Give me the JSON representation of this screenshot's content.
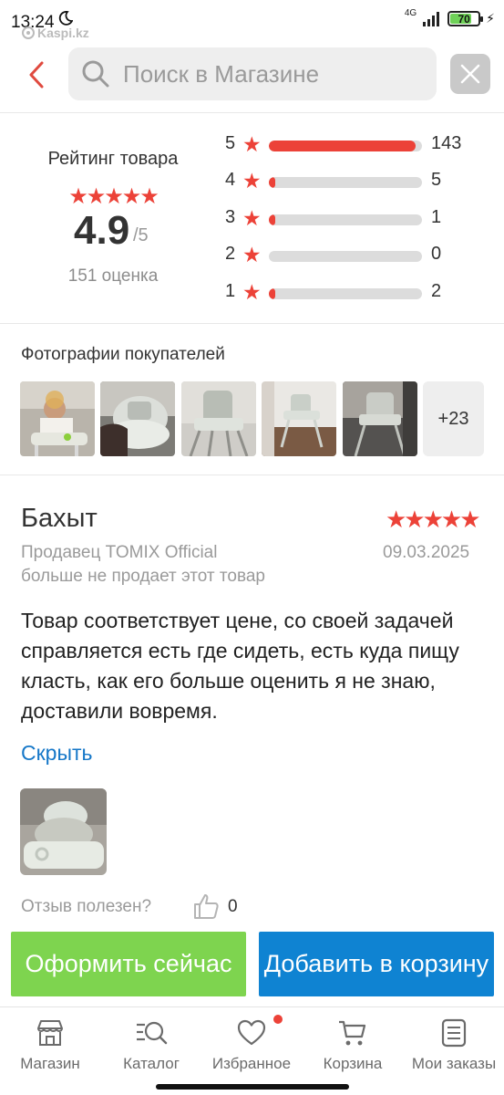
{
  "status_bar": {
    "time": "13:24",
    "app_name": "Kaspi.kz",
    "network": "4G",
    "battery": "70"
  },
  "header": {
    "search_placeholder": "Поиск в Магазине"
  },
  "rating": {
    "title": "Рейтинг товара",
    "stars": "★★★★★",
    "score": "4.9",
    "max": "/5",
    "count_text": "151 оценка",
    "rows": [
      {
        "stars": "5",
        "count": "143",
        "fraction": 0.96
      },
      {
        "stars": "4",
        "count": "5",
        "fraction": 0.035
      },
      {
        "stars": "3",
        "count": "1",
        "fraction": 0.007
      },
      {
        "stars": "2",
        "count": "0",
        "fraction": 0
      },
      {
        "stars": "1",
        "count": "2",
        "fraction": 0.014
      }
    ]
  },
  "photos": {
    "title": "Фотографии покупателей",
    "more_label": "+23"
  },
  "review": {
    "author": "Бахыт",
    "stars": "★★★★★",
    "seller": "Продавец TOMIX Official",
    "date": "09.03.2025",
    "note": "больше не продает этот товар",
    "text": "Товар соответствует цене, со своей задачей справляется есть где сидеть, есть куда пищу класть, как его больше оценить я не знаю, доставили вовремя.",
    "hide_label": "Скрыть",
    "helpful_label": "Отзыв полезен?",
    "helpful_count": "0"
  },
  "actions": {
    "buy_label": "Оформить сейчас",
    "cart_label": "Добавить в корзину"
  },
  "nav": {
    "items": [
      {
        "label": "Магазин",
        "icon": "shop-icon"
      },
      {
        "label": "Каталог",
        "icon": "catalog-search-icon"
      },
      {
        "label": "Избранное",
        "icon": "heart-icon"
      },
      {
        "label": "Корзина",
        "icon": "cart-icon"
      },
      {
        "label": "Мои заказы",
        "icon": "orders-icon"
      }
    ]
  },
  "colors": {
    "accent_red": "#ec4238",
    "buy_green": "#7ed44f",
    "cart_blue": "#0f83d2",
    "link_blue": "#1577c8"
  }
}
